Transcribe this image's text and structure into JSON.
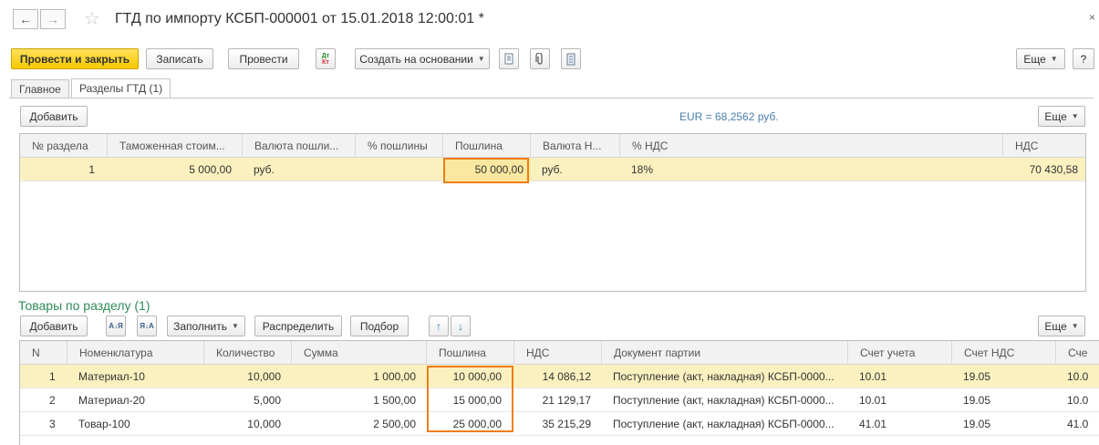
{
  "window": {
    "title": "ГТД по импорту КСБП-000001 от 15.01.2018 12:00:01 *",
    "back_icon": "←",
    "forward_icon": "→",
    "star_icon": "☆",
    "close_icon": "×"
  },
  "toolbar": {
    "post_close_label": "Провести и закрыть",
    "save_label": "Записать",
    "post_label": "Провести",
    "dt_kt_label": "Дт Кт",
    "create_based_label": "Создать на основании",
    "more_label": "Еще",
    "help_label": "?"
  },
  "tabs": [
    {
      "label": "Главное"
    },
    {
      "label": "Разделы ГТД (1)"
    }
  ],
  "sections": {
    "add_label": "Добавить",
    "rate_text": "EUR = 68,2562 руб.",
    "more_label": "Еще",
    "columns": [
      "№ раздела",
      "Таможенная стоим...",
      "Валюта пошли...",
      "% пошлины",
      "Пошлина",
      "Валюта Н...",
      "% НДС",
      "НДС"
    ],
    "rows": [
      {
        "num": "1",
        "customs_value": "5 000,00",
        "duty_currency": "руб.",
        "duty_percent": "",
        "duty": "50 000,00",
        "vat_currency": "руб.",
        "vat_percent": "18%",
        "vat": "70 430,58"
      }
    ]
  },
  "goods": {
    "title": "Товары по разделу (1)",
    "add_label": "Добавить",
    "fill_label": "Заполнить",
    "distribute_label": "Распределить",
    "pick_label": "Подбор",
    "more_label": "Еще",
    "sort_asc_icon": "А↓Я",
    "sort_desc_icon": "Я↓А",
    "up_icon": "↑",
    "down_icon": "↓",
    "columns": [
      "N",
      "Номенклатура",
      "Количество",
      "Сумма",
      "Пошлина",
      "НДС",
      "Документ партии",
      "Счет учета",
      "Счет НДС",
      "Сче"
    ],
    "rows": [
      {
        "n": "1",
        "item": "Материал-10",
        "qty": "10,000",
        "sum": "1 000,00",
        "duty": "10 000,00",
        "vat": "14 086,12",
        "doc": "Поступление (акт, накладная) КСБП-0000...",
        "account": "10.01",
        "vat_account": "19.05",
        "extra": "10.0"
      },
      {
        "n": "2",
        "item": "Материал-20",
        "qty": "5,000",
        "sum": "1 500,00",
        "duty": "15 000,00",
        "vat": "21 129,17",
        "doc": "Поступление (акт, накладная) КСБП-0000...",
        "account": "10.01",
        "vat_account": "19.05",
        "extra": "10.0"
      },
      {
        "n": "3",
        "item": "Товар-100",
        "qty": "10,000",
        "sum": "2 500,00",
        "duty": "25 000,00",
        "vat": "35 215,29",
        "doc": "Поступление (акт, накладная) КСБП-0000...",
        "account": "41.01",
        "vat_account": "19.05",
        "extra": "41.0"
      }
    ]
  },
  "colors": {
    "primary": "#f5c800",
    "highlight": "#f07d1a",
    "selected_row": "#fbf1bf",
    "section_title": "#2e8a57"
  }
}
